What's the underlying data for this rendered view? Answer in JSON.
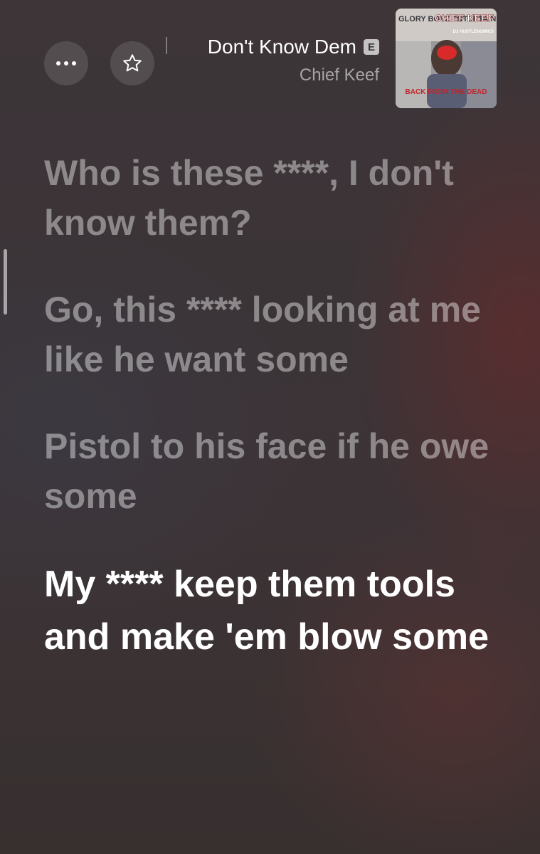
{
  "header": {
    "track_title": "Don't Know Dem",
    "explicit_badge": "E",
    "artist": "Chief Keef",
    "more_icon": "ellipsis-icon",
    "favorite_icon": "star-outline-icon"
  },
  "artwork": {
    "label_top_left": "GLORY BOYZ ENTERTAINMENT",
    "label_top_right": "CHIEF KEEF",
    "label_small": "DJ HUSTLENOMICS",
    "label_center": "BACK FROM THE DEAD"
  },
  "lyrics": [
    {
      "text": "Who is these ****, I don't know them?",
      "active": false
    },
    {
      "text": "Go, this **** looking at me like he want some",
      "active": false
    },
    {
      "text": "Pistol to his face if he owe some",
      "active": false
    },
    {
      "text": "My **** keep them tools and make 'em blow some",
      "active": true
    }
  ],
  "colors": {
    "active_lyric": "#ffffff",
    "inactive_lyric": "rgba(255,255,255,0.42)",
    "accent_red": "#b8252a"
  }
}
